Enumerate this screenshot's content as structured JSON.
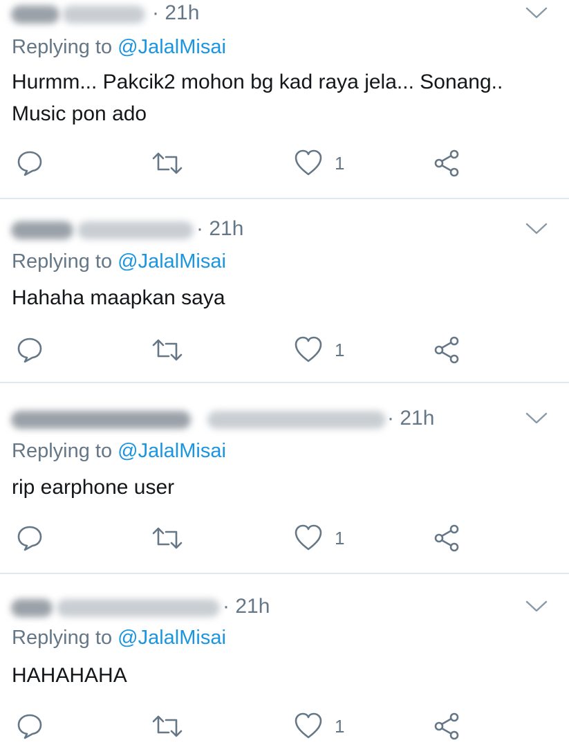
{
  "tweets": [
    {
      "time": "· 21h",
      "replying_prefix": "Replying to ",
      "replying_handle": "@JalalMisai",
      "text_lines": [
        "Hurmm... Pakcik2 mohon bg kad raya jela... Sonang..",
        "Music pon ado"
      ],
      "likes": "1"
    },
    {
      "time": "· 21h",
      "replying_prefix": "Replying to ",
      "replying_handle": "@JalalMisai",
      "text_lines": [
        "Hahaha maapkan saya"
      ],
      "likes": "1"
    },
    {
      "time": "· 21h",
      "replying_prefix": "Replying to ",
      "replying_handle": "@JalalMisai",
      "text_lines": [
        "rip earphone user"
      ],
      "likes": "1"
    },
    {
      "time": "· 21h",
      "replying_prefix": "Replying to ",
      "replying_handle": "@JalalMisai",
      "text_lines": [
        "HAHAHAHA"
      ],
      "likes": "1"
    }
  ],
  "icons": {
    "reply": "reply-icon",
    "retweet": "retweet-icon",
    "like": "heart-icon",
    "share": "share-icon",
    "caret": "chevron-down-icon"
  },
  "colors": {
    "secondary_text": "#657786",
    "link": "#1b95e0",
    "divider": "#e1e8ed",
    "icon_stroke": "#657786"
  }
}
